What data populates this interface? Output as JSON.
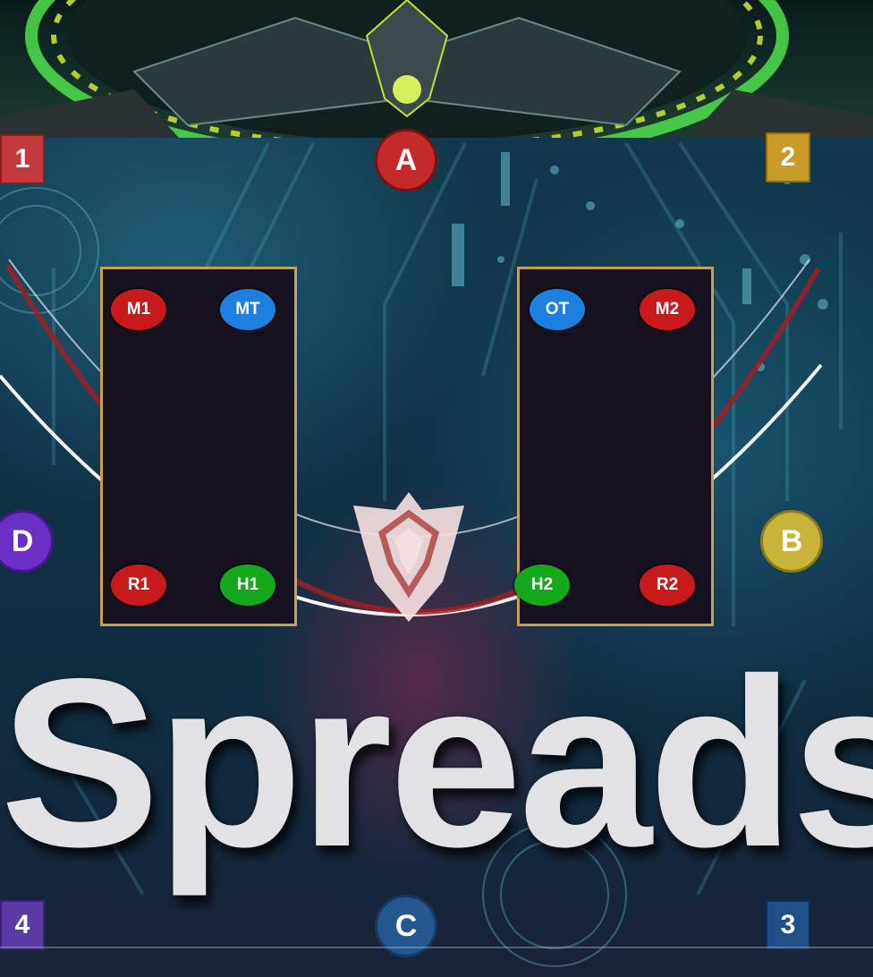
{
  "waymarks": {
    "one": {
      "label": "1",
      "color": "#c43a3a"
    },
    "two": {
      "label": "2",
      "color": "#c99a26"
    },
    "three": {
      "label": "3",
      "color": "#1f4f86"
    },
    "four": {
      "label": "4",
      "color": "#5a3aa4"
    },
    "a": {
      "label": "A",
      "color": "#c42a2a"
    },
    "b": {
      "label": "B",
      "color": "#c9b43a"
    },
    "c": {
      "label": "C",
      "color": "#24578f"
    },
    "d": {
      "label": "D",
      "color": "#6a2fc4"
    }
  },
  "left_platform": {
    "top_left": "M1",
    "top_right": "MT",
    "bottom_left": "R1",
    "bottom_right": "H1"
  },
  "right_platform": {
    "top_left": "OT",
    "top_right": "M2",
    "bottom_left": "H2",
    "bottom_right": "R2"
  },
  "title": "Spreads",
  "colors": {
    "dps": "#c81a1a",
    "tank": "#1d7fe0",
    "healer": "#14a81c",
    "platform_border": "#c9a04c",
    "arc_white": "#f4f4f4",
    "arc_red": "#9c1e24"
  }
}
